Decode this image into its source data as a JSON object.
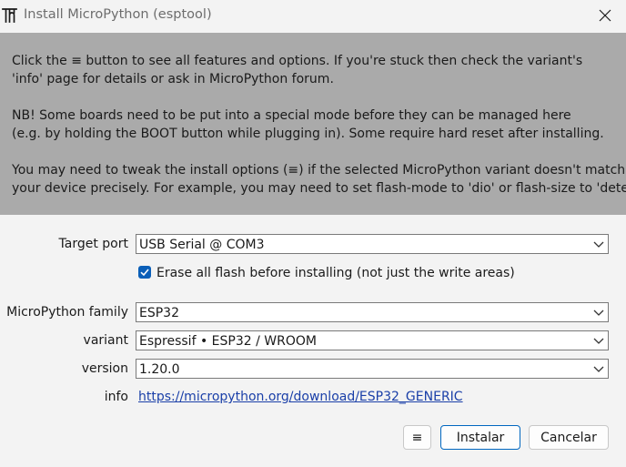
{
  "window": {
    "title": "Install MicroPython (esptool)"
  },
  "info": {
    "lines": [
      "Click the ≡ button to see all features and options. If you're stuck then check the variant's",
      "'info' page for details or ask in MicroPython forum.",
      "NB! Some boards need to be put into a special mode before they can be managed here",
      "(e.g. by holding the BOOT button while plugging in). Some require hard reset after installing.",
      "You may need to tweak the install options (≡) if the selected MicroPython variant doesn't match",
      "your device precisely. For example, you may need to set flash-mode to 'dio' or flash-size to 'detect'."
    ]
  },
  "form": {
    "target_port": {
      "label": "Target port",
      "value": "USB Serial @ COM3"
    },
    "erase_flash": {
      "label": "Erase all flash before installing (not just the write areas)",
      "checked": true
    },
    "family": {
      "label": "MicroPython family",
      "value": "ESP32"
    },
    "variant": {
      "label": "variant",
      "value": "Espressif • ESP32 / WROOM"
    },
    "version": {
      "label": "version",
      "value": "1.20.0"
    },
    "info": {
      "label": "info",
      "link": "https://micropython.org/download/ESP32_GENERIC"
    }
  },
  "buttons": {
    "menu_label": "≡",
    "install_label": "Instalar",
    "cancel_label": "Cancelar"
  },
  "colors": {
    "info_panel_bg": "#aaaaaa",
    "accent": "#0a5fb8",
    "link": "#1a3fa8"
  }
}
